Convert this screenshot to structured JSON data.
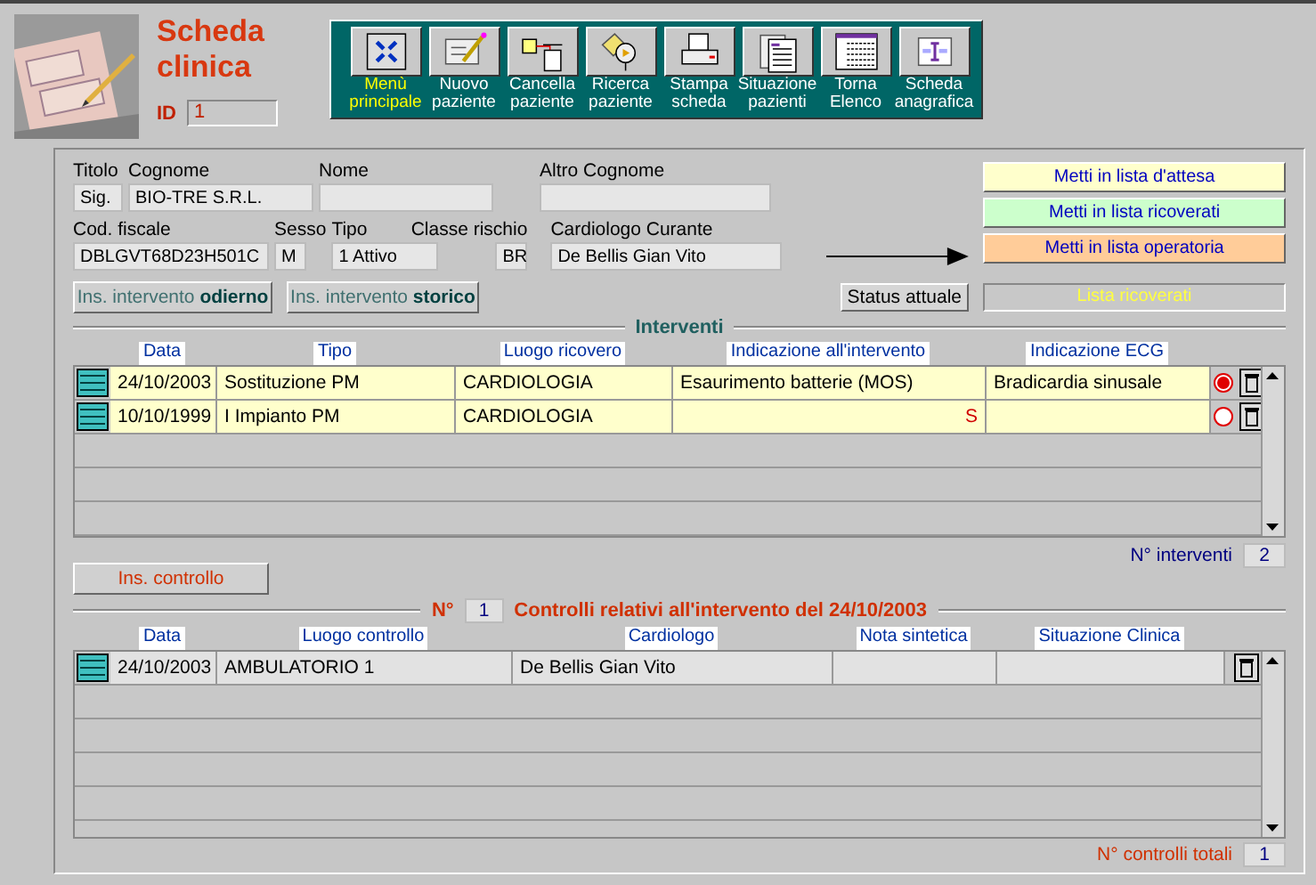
{
  "header": {
    "title": "Scheda clinica",
    "id_label": "ID",
    "id": "1"
  },
  "toolbar": [
    {
      "label": "Menù principale",
      "kind": "menu",
      "selected": true
    },
    {
      "label": "Nuovo paziente",
      "kind": "new",
      "selected": false
    },
    {
      "label": "Cancella paziente",
      "kind": "delete",
      "selected": false
    },
    {
      "label": "Ricerca paziente",
      "kind": "search",
      "selected": false
    },
    {
      "label": "Stampa scheda",
      "kind": "print",
      "selected": false
    },
    {
      "label": "Situazione pazienti",
      "kind": "report",
      "selected": false
    },
    {
      "label": "Torna Elenco",
      "kind": "list",
      "selected": false
    },
    {
      "label": "Scheda anagrafica",
      "kind": "card",
      "selected": false
    }
  ],
  "patient": {
    "titolo": {
      "label": "Titolo",
      "value": "Sig."
    },
    "cognome": {
      "label": "Cognome",
      "value": "BIO-TRE S.R.L."
    },
    "nome": {
      "label": "Nome"
    },
    "altro_cognome": {
      "label": "Altro Cognome"
    },
    "codice_fiscale": {
      "label": "Cod. fiscale",
      "value": "DBLGVT68D23H501C"
    },
    "sesso": {
      "label": "Sesso",
      "value": "M"
    },
    "tipo": {
      "label": "Tipo",
      "value": "1 Attivo"
    },
    "classe_rischio": {
      "label": "Classe rischio",
      "value": "BR"
    },
    "cardiologo": {
      "label": "Cardiologo Curante",
      "value": "De Bellis  Gian Vito"
    }
  },
  "list_buttons": [
    {
      "label": "Metti in lista d'attesa",
      "color": "#ffffcc"
    },
    {
      "label": "Metti in lista ricoverati",
      "color": "#ccffcc"
    },
    {
      "label": "Metti in lista operatoria",
      "color": "#ffcc99"
    }
  ],
  "insert_buttons": [
    {
      "label": "Ins. intervento **odierno**"
    },
    {
      "label": "Ins. intervento **storico**"
    }
  ],
  "status": {
    "label": "Status attuale",
    "value": "Lista ricoverati"
  },
  "interventi": {
    "title": "Interventi",
    "columns": [
      "Data",
      "Tipo",
      "Luogo ricovero",
      "Indicazione all'intervento",
      "Indicazione ECG"
    ],
    "rows": [
      {
        "selected": true,
        "cells": [
          {
            "kind": "plain",
            "text": "24/10/2003"
          },
          {
            "kind": "plain",
            "text": "Sostituzione  PM"
          },
          {
            "kind": "plain",
            "text": "CARDIOLOGIA"
          },
          {
            "kind": "plain",
            "text": "Esaurimento batterie (MOS)"
          },
          {
            "kind": "plain",
            "text": "Bradicardia sinusale"
          }
        ]
      },
      {
        "selected": false,
        "cells": [
          {
            "kind": "plain",
            "text": "10/10/1999"
          },
          {
            "kind": "plain",
            "text": "I Impianto  PM"
          },
          {
            "kind": "plain",
            "text": "CARDIOLOGIA"
          },
          {
            "kind": "flag",
            "text": "S"
          },
          {
            "kind": "empty"
          }
        ]
      }
    ],
    "count_label": "N° interventi",
    "count": "2"
  },
  "controlli": {
    "insert_button": "Ins. controllo",
    "number_label": "N°",
    "number": "1",
    "title": "Controlli relativi all'intervento del 24/10/2003",
    "columns": [
      "Data",
      "Luogo controllo",
      "Cardiologo",
      "Nota sintetica",
      "Situazione Clinica"
    ],
    "rows": [
      {
        "cells": [
          {
            "kind": "plain",
            "text": "24/10/2003"
          },
          {
            "kind": "plain",
            "text": "AMBULATORIO 1"
          },
          {
            "kind": "plain",
            "text": "De Bellis  Gian Vito"
          },
          {
            "kind": "empty"
          },
          {
            "kind": "empty"
          }
        ]
      }
    ],
    "count_label": "N° controlli totali",
    "count": "1"
  }
}
